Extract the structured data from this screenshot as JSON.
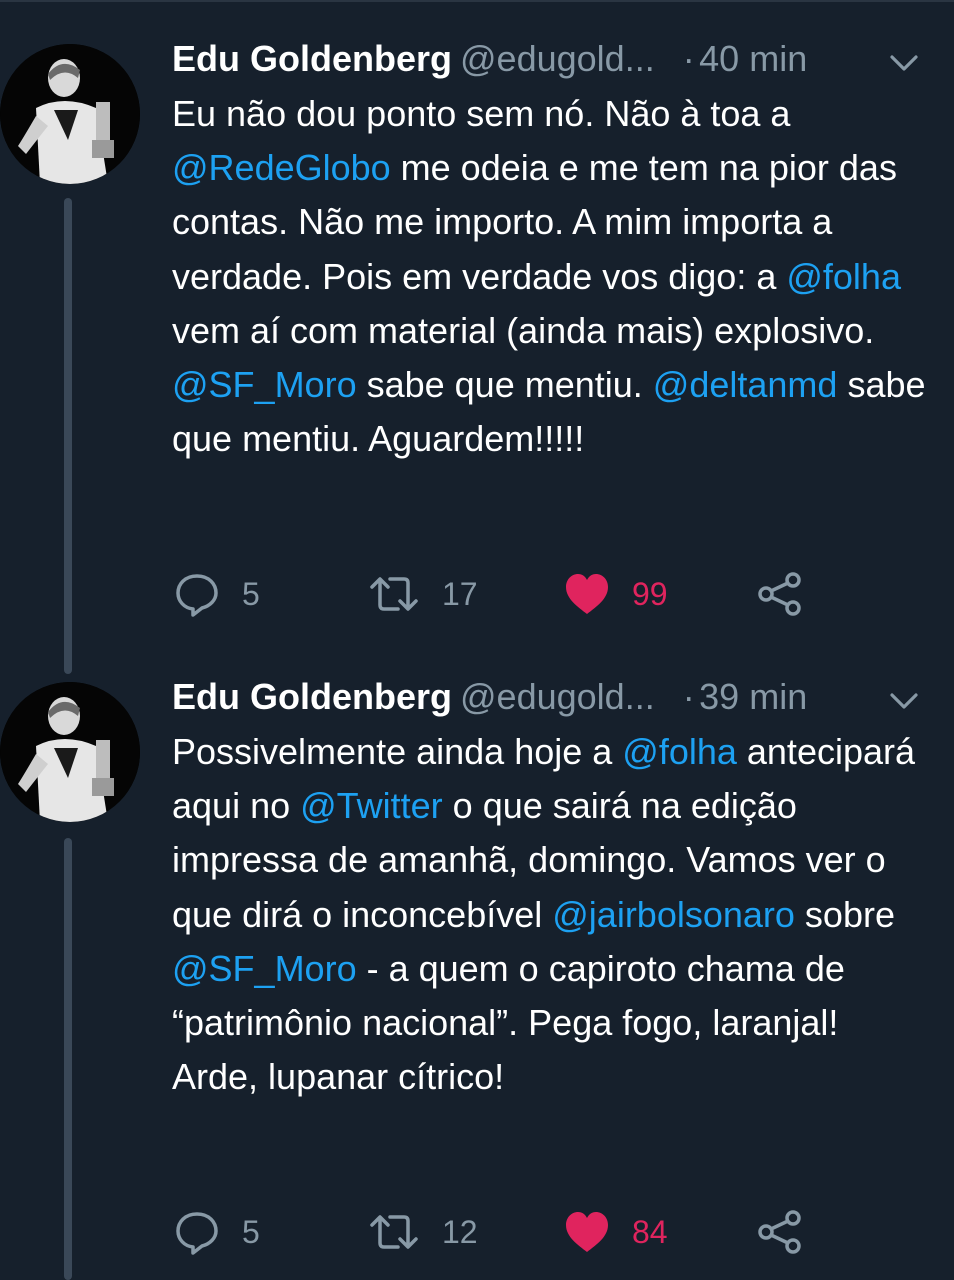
{
  "colors": {
    "background": "#16202c",
    "mention": "#1da1f2",
    "muted": "#8899a6",
    "like": "#e0245e"
  },
  "icons": [
    "avatar-photo",
    "chevron-down-icon",
    "reply-icon",
    "retweet-icon",
    "heart-icon",
    "share-icon"
  ],
  "tweets": [
    {
      "author": "Edu Goldenberg",
      "handle": "@edugold...",
      "separator": "·",
      "time": "40 min",
      "text": [
        "Eu não dou ponto sem nó. Não à toa a ",
        "@RedeGlobo",
        " me odeia e me tem na pior das contas. Não me importo. A mim importa a verdade. Pois em verdade vos digo: a ",
        "@folha",
        " vem aí com material (ainda mais) explosivo. ",
        "@SF_Moro",
        " sabe que mentiu. ",
        "@deltanmd",
        " sabe que mentiu. Aguardem!!!!!"
      ],
      "replies": "5",
      "retweets": "17",
      "likes": "99"
    },
    {
      "author": "Edu Goldenberg",
      "handle": "@edugold...",
      "separator": "·",
      "time": "39 min",
      "text": [
        "Possivelmente ainda hoje a ",
        "@folha",
        " antecipará aqui no ",
        "@Twitter",
        " o que sairá na edição impressa de amanhã, domingo. Vamos ver o que dirá o inconcebível ",
        "@jairbolsonaro",
        " sobre ",
        "@SF_Moro",
        " - a quem o capiroto chama de “patrimônio nacional”. Pega fogo, laranjal! Arde, lupanar cítrico!"
      ],
      "replies": "5",
      "retweets": "12",
      "likes": "84"
    }
  ]
}
